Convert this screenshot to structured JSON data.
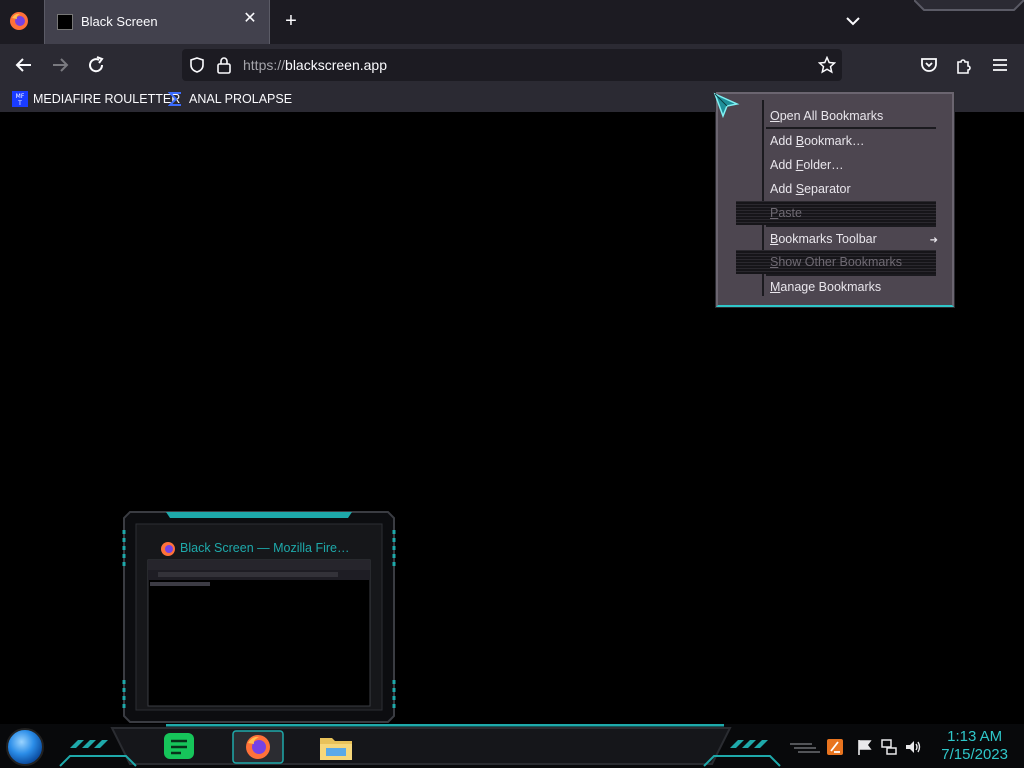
{
  "browser": {
    "tab": {
      "title": "Black Screen",
      "close_symbol": "✕"
    },
    "new_tab_symbol": "+",
    "url": {
      "scheme": "https://",
      "host": "blackscreen.app"
    }
  },
  "bookmarks_toolbar": {
    "items": [
      {
        "label": "MEDIAFIRE ROULETTER",
        "icon": "mft-icon"
      },
      {
        "label": "ANAL PROLAPSE",
        "icon": "sigma-icon"
      }
    ]
  },
  "context_menu": {
    "items": [
      {
        "pre": "",
        "key": "O",
        "post": "pen All Bookmarks"
      },
      {
        "pre": "Add ",
        "key": "B",
        "post": "ookmark…"
      },
      {
        "pre": "Add ",
        "key": "F",
        "post": "older…"
      },
      {
        "pre": "Add ",
        "key": "S",
        "post": "eparator"
      },
      {
        "pre": "",
        "key": "P",
        "post": "aste"
      },
      {
        "pre": "",
        "key": "B",
        "post": "ookmarks Toolbar"
      },
      {
        "pre": "",
        "key": "S",
        "post": "how Other Bookmarks"
      },
      {
        "pre": "",
        "key": "M",
        "post": "anage Bookmarks"
      }
    ]
  },
  "taskbar": {
    "preview_title": "Black Screen — Mozilla Fire…",
    "clock": {
      "time": "1:13 AM",
      "date": "7/15/2023"
    }
  },
  "colors": {
    "accent": "#2fc7c9",
    "toolbar": "#2b2a33",
    "tabstrip": "#1c1b22"
  }
}
